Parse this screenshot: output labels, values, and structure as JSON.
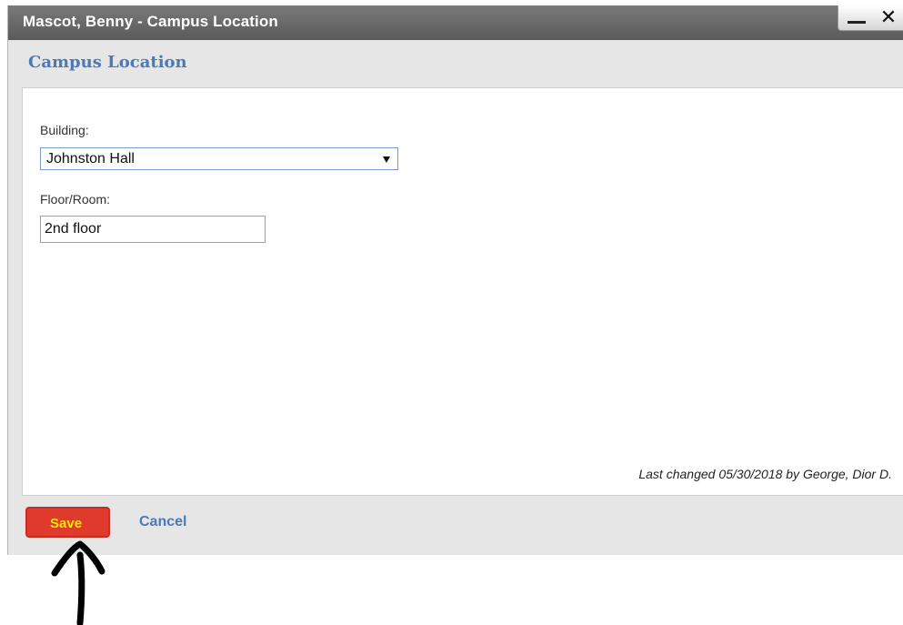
{
  "window": {
    "title": "Mascot, Benny - Campus Location",
    "minimize_icon": "minimize-icon",
    "close_icon": "close-icon",
    "close_glyph": "✕"
  },
  "form": {
    "section_title": "Campus Location",
    "building_label": "Building:",
    "building_value": "Johnston Hall",
    "floor_label": "Floor/Room:",
    "floor_value": "2nd floor",
    "last_changed": "Last changed 05/30/2018 by George, Dior D."
  },
  "actions": {
    "save_label": "Save",
    "cancel_label": "Cancel"
  },
  "colors": {
    "accent_blue": "#4a7ab8",
    "save_bg": "#e03a2c",
    "save_text": "#ffe800",
    "titlebar": "#666666"
  }
}
